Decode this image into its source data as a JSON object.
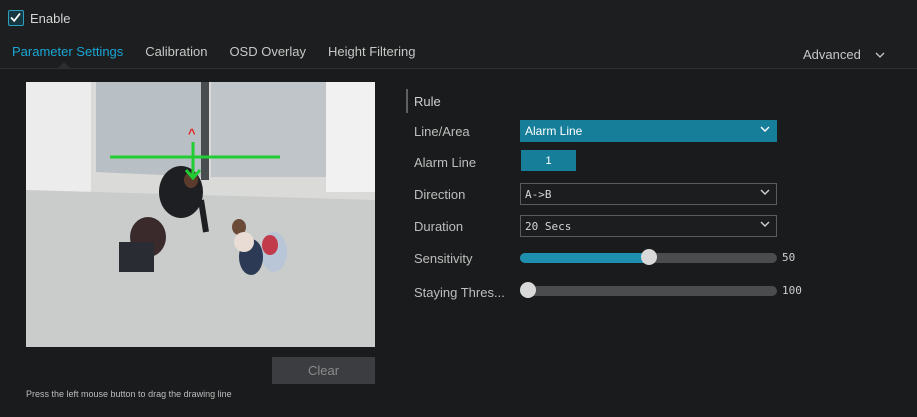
{
  "header": {
    "enable_label": "Enable",
    "enable_checked": true
  },
  "tabs": [
    {
      "label": "Parameter Settings",
      "active": true
    },
    {
      "label": "Calibration",
      "active": false
    },
    {
      "label": "OSD Overlay",
      "active": false
    },
    {
      "label": "Height Filtering",
      "active": false
    }
  ],
  "advanced": {
    "label": "Advanced"
  },
  "video": {
    "arrow_label": "^"
  },
  "actions": {
    "clear_label": "Clear"
  },
  "hint": "Press the left mouse button to drag the drawing line",
  "rule": {
    "title": "Rule",
    "line_area": {
      "label": "Line/Area",
      "value": "Alarm Line"
    },
    "alarm_line": {
      "label": "Alarm Line",
      "value": "1"
    },
    "direction": {
      "label": "Direction",
      "value": "A->B"
    },
    "duration": {
      "label": "Duration",
      "value": "20 Secs"
    },
    "sensitivity": {
      "label": "Sensitivity",
      "value": "50",
      "fraction": 0.5
    },
    "staying": {
      "label": "Staying Thres...",
      "value": "100",
      "fraction": 0.0
    }
  },
  "colors": {
    "accent": "#167e99",
    "active_tab": "#1aa6d6",
    "rule_line": "#22cc33",
    "arrow": "#e02020"
  }
}
